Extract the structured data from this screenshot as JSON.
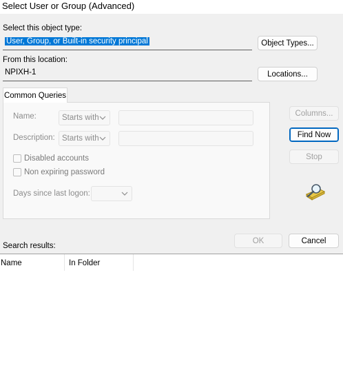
{
  "window": {
    "title": "Select User or Group (Advanced)"
  },
  "object_type": {
    "label": "Select this object type:",
    "value": "User, Group, or Built-in security principal",
    "button": "Object Types..."
  },
  "location": {
    "label": "From this location:",
    "value": "NPIXH-1",
    "button": "Locations..."
  },
  "tab": {
    "label": "Common Queries"
  },
  "queries": {
    "name_label": "Name:",
    "name_mode": "Starts with",
    "description_label": "Description:",
    "description_mode": "Starts with",
    "disabled_accounts": "Disabled accounts",
    "non_expiring_password": "Non expiring password",
    "days_since_logon_label": "Days since last logon:"
  },
  "side_buttons": {
    "columns": "Columns...",
    "find_now": "Find Now",
    "stop": "Stop"
  },
  "footer": {
    "search_results_label": "Search results:",
    "ok": "OK",
    "cancel": "Cancel"
  },
  "results": {
    "columns": [
      "Name",
      "In Folder"
    ]
  },
  "colors": {
    "accent": "#0078d7",
    "dialog_bg": "#f0f0f0",
    "default_button_border": "#0067c0"
  }
}
